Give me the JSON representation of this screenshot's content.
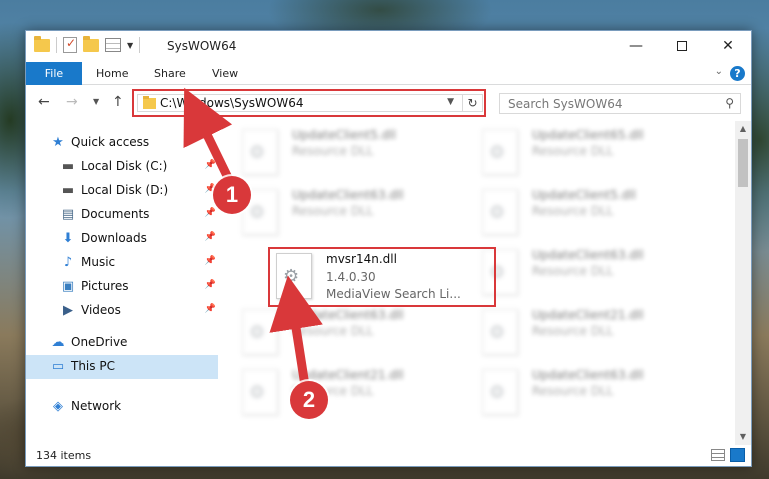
{
  "window": {
    "title": "SysWOW64",
    "min_glyph": "—",
    "close_glyph": "✕"
  },
  "ribbon": {
    "tabs": [
      "File",
      "Home",
      "Share",
      "View"
    ],
    "help_glyph": "?"
  },
  "address": {
    "path": "C:\\Windows\\SysWOW64",
    "search_placeholder": "Search SysWOW64"
  },
  "sidebar": {
    "items": [
      {
        "label": "Quick access",
        "icon": "star-icon",
        "glyph": "★",
        "color": "#2f7fd4",
        "pinned": false
      },
      {
        "label": "Local Disk (C:)",
        "icon": "drive-icon",
        "glyph": "▬",
        "color": "#555555",
        "pinned": true
      },
      {
        "label": "Local Disk (D:)",
        "icon": "drive-icon",
        "glyph": "▬",
        "color": "#555555",
        "pinned": true
      },
      {
        "label": "Documents",
        "icon": "document-icon",
        "glyph": "▤",
        "color": "#4a6b8a",
        "pinned": true
      },
      {
        "label": "Downloads",
        "icon": "download-icon",
        "glyph": "⬇",
        "color": "#2f7fd4",
        "pinned": true
      },
      {
        "label": "Music",
        "icon": "music-icon",
        "glyph": "♪",
        "color": "#2f7fd4",
        "pinned": true
      },
      {
        "label": "Pictures",
        "icon": "pictures-icon",
        "glyph": "▣",
        "color": "#3a7fc0",
        "pinned": true
      },
      {
        "label": "Videos",
        "icon": "videos-icon",
        "glyph": "▶",
        "color": "#3a5f8a",
        "pinned": true
      },
      {
        "label": "OneDrive",
        "icon": "cloud-icon",
        "glyph": "☁",
        "color": "#2f7fd4",
        "pinned": false
      },
      {
        "label": "This PC",
        "icon": "computer-icon",
        "glyph": "▭",
        "color": "#2f7fd4",
        "pinned": false
      },
      {
        "label": "Network",
        "icon": "network-icon",
        "glyph": "◈",
        "color": "#2f7fd4",
        "pinned": false
      }
    ]
  },
  "files": {
    "blurred": [
      {
        "name": "UpdateClient5.dll",
        "type": "Resource DLL"
      },
      {
        "name": "UpdateClient65.dll",
        "type": "Resource DLL"
      },
      {
        "name": "UpdateClient63.dll",
        "type": "Resource DLL"
      },
      {
        "name": "UpdateClient5.dll",
        "type": "Resource DLL"
      },
      {
        "name": "UpdateClient63.dll",
        "type": "Resource DLL"
      },
      {
        "name": "UpdateClient63.dll",
        "type": "Resource DLL"
      },
      {
        "name": "UpdateClient21.dll",
        "type": "Resource DLL"
      },
      {
        "name": "UpdateClient21.dll",
        "type": "Resource DLL"
      },
      {
        "name": "UpdateClient63.dll",
        "type": "Resource DLL"
      }
    ],
    "selected": {
      "name": "mvsr14n.dll",
      "version": "1.4.0.30",
      "description": "MediaView Search Li..."
    }
  },
  "status": {
    "item_count": "134 items"
  },
  "callouts": {
    "one": "1",
    "two": "2",
    "color": "#d9383a"
  }
}
